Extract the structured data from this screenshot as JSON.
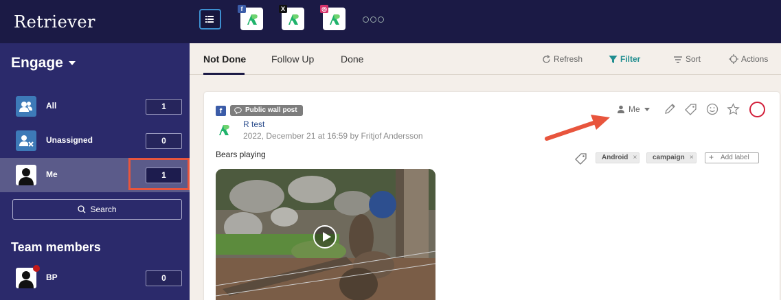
{
  "header": {
    "brand": "Retriever",
    "channels": [
      {
        "icon": "facebook-icon",
        "badge": "f",
        "badge_color": "#3b5ca8"
      },
      {
        "icon": "x-icon",
        "badge": "X",
        "badge_color": "#111111"
      },
      {
        "icon": "instagram-icon",
        "badge": "◎",
        "badge_color": "#d6336c"
      }
    ]
  },
  "sidebar": {
    "title": "Engage",
    "items": [
      {
        "label": "All",
        "count": "1",
        "icon": "users-icon"
      },
      {
        "label": "Unassigned",
        "count": "0",
        "icon": "user-x-icon"
      },
      {
        "label": "Me",
        "count": "1",
        "icon": "avatar-icon"
      }
    ],
    "search_label": "Search",
    "team_title": "Team members",
    "team": [
      {
        "label": "BP",
        "count": "0"
      }
    ]
  },
  "tabs": {
    "items": [
      "Not Done",
      "Follow Up",
      "Done"
    ],
    "active": "Not Done",
    "actions": {
      "refresh": "Refresh",
      "filter": "Filter",
      "sort": "Sort",
      "actions": "Actions"
    }
  },
  "post": {
    "type_label": "Public wall post",
    "author": "R test",
    "meta": "2022, December 21 at 16:59 by Fritjof Andersson",
    "text": "Bears playing",
    "assignee": "Me",
    "labels": [
      "Android",
      "campaign"
    ],
    "add_label": "Add label"
  },
  "colors": {
    "topbar": "#1b1a45",
    "sidebar": "#2b2a6b",
    "accent_teal": "#1f8d8f",
    "highlight": "#e8553d",
    "status_ring": "#d21f3a"
  }
}
